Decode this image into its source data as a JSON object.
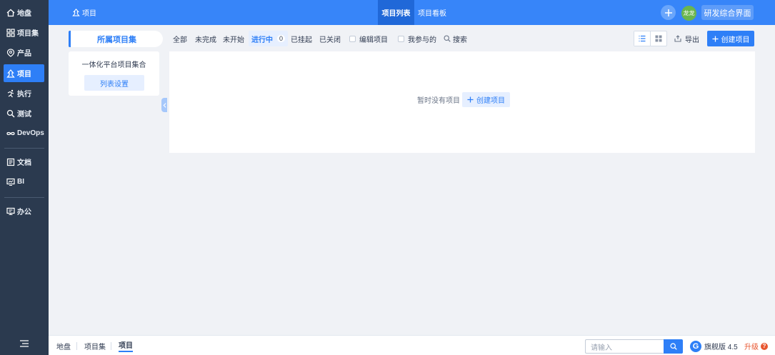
{
  "sidebar": {
    "items": [
      {
        "label": "地盘",
        "icon": "home-icon"
      },
      {
        "label": "项目集",
        "icon": "grid-icon"
      },
      {
        "label": "产品",
        "icon": "product-icon"
      },
      {
        "label": "项目",
        "icon": "project-icon",
        "active": true
      },
      {
        "label": "执行",
        "icon": "run-icon"
      },
      {
        "label": "测试",
        "icon": "test-icon"
      },
      {
        "label": "DevOps",
        "icon": "infinity-icon"
      },
      {
        "label": "文档",
        "icon": "doc-icon"
      },
      {
        "label": "BI",
        "icon": "monitor-icon"
      },
      {
        "label": "办公",
        "icon": "office-icon"
      }
    ]
  },
  "header": {
    "title": "项目",
    "tabs": [
      {
        "label": "项目列表",
        "active": true
      },
      {
        "label": "项目看板",
        "active": false
      }
    ],
    "avatar_text": "龙龙",
    "org_label": "研发综合界面"
  },
  "program_set": {
    "tab_label": "所属项目集",
    "name": "一体化平台项目集合",
    "settings_label": "列表设置"
  },
  "filters": {
    "all": "全部",
    "undone": "未完成",
    "not_started": "未开始",
    "in_progress": "进行中",
    "in_progress_count": "0",
    "suspended": "已挂起",
    "closed": "已关闭",
    "edit_project": "编辑项目",
    "involved": "我参与的",
    "search": "搜索"
  },
  "toolbar": {
    "export": "导出",
    "create": "创建项目"
  },
  "empty_state": {
    "message": "暂时没有项目",
    "create": "创建项目"
  },
  "footer": {
    "crumbs": [
      "地盘",
      "项目集",
      "项目"
    ],
    "search_placeholder": "请输入",
    "edition": "旗舰版 4.5",
    "upgrade": "升级"
  },
  "colors": {
    "primary": "#2e7ff7",
    "header": "#3785f9",
    "sidebar": "#2b3a4f"
  }
}
